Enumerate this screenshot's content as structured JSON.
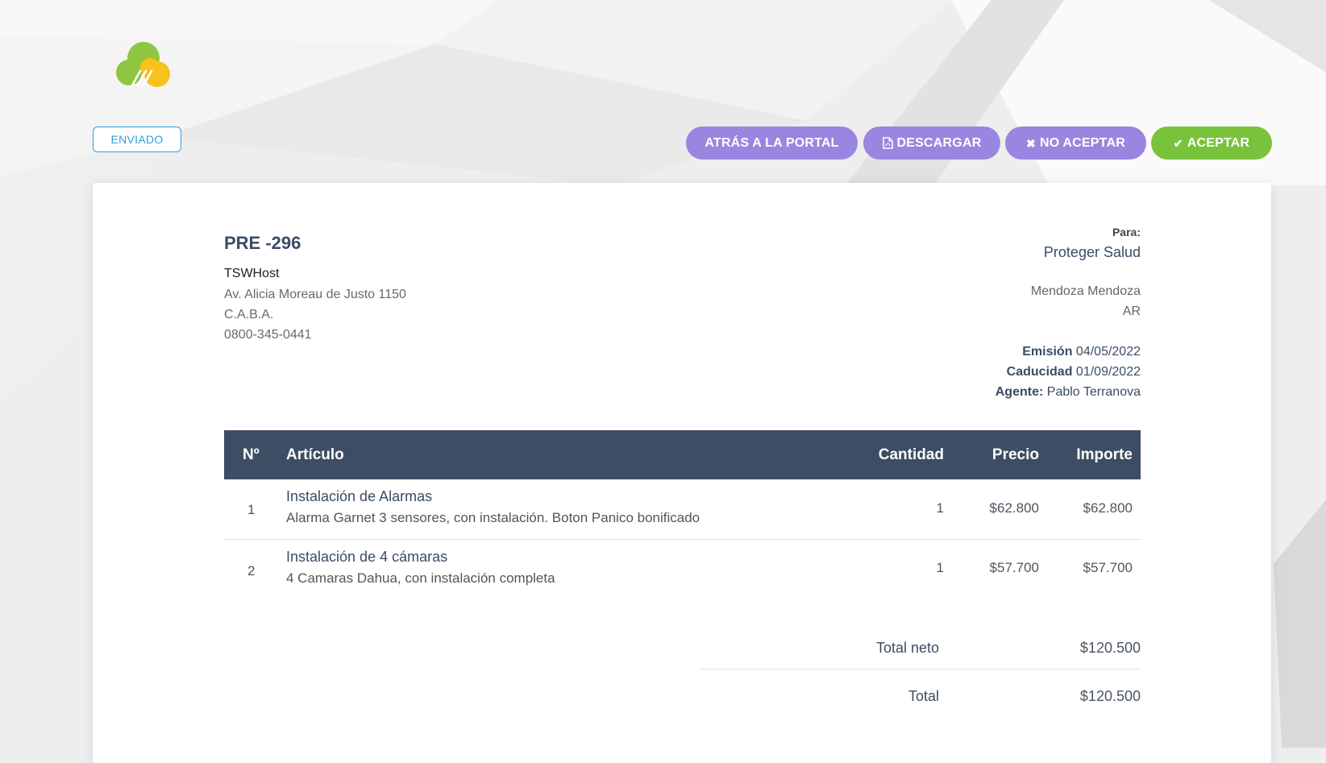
{
  "status": "ENVIADO",
  "actions": {
    "back": "ATRÁS A LA PORTAL",
    "download": "DESCARGAR",
    "reject": "NO ACEPTAR",
    "accept": "ACEPTAR"
  },
  "colors": {
    "purple": "#9a86e0",
    "green": "#79c23b",
    "header": "#3d4d63",
    "status_blue": "#2e9fd4"
  },
  "icons": {
    "download": "file-pdf-icon",
    "reject": "times-icon",
    "accept": "check-icon",
    "logo": "cloud-logo"
  },
  "estimate": {
    "number": "PRE -296",
    "company": "TSWHost",
    "address": [
      "Av. Alicia Moreau de Justo 1150",
      "C.A.B.A.",
      "0800-345-0441"
    ]
  },
  "client": {
    "label": "Para:",
    "name": "Proteger Salud",
    "city": "Mendoza Mendoza",
    "country": "AR"
  },
  "meta": {
    "issued_label": "Emisión",
    "issued": "04/05/2022",
    "expiry_label": "Caducidad",
    "expiry": "01/09/2022",
    "agent_label": "Agente:",
    "agent": "Pablo Terranova"
  },
  "table": {
    "headers": {
      "num": "Nº",
      "item": "Artículo",
      "qty": "Cantidad",
      "price": "Precio",
      "amount": "Importe"
    },
    "rows": [
      {
        "num": "1",
        "name": "Instalación de Alarmas",
        "desc": "Alarma Garnet 3 sensores, con instalación. Boton Panico bonificado",
        "qty": "1",
        "price": "$62.800",
        "amount": "$62.800"
      },
      {
        "num": "2",
        "name": "Instalación de 4 cámaras",
        "desc": "4 Camaras Dahua, con instalación completa",
        "qty": "1",
        "price": "$57.700",
        "amount": "$57.700"
      }
    ]
  },
  "totals": {
    "net_label": "Total neto",
    "net": "$120.500",
    "total_label": "Total",
    "total": "$120.500"
  }
}
